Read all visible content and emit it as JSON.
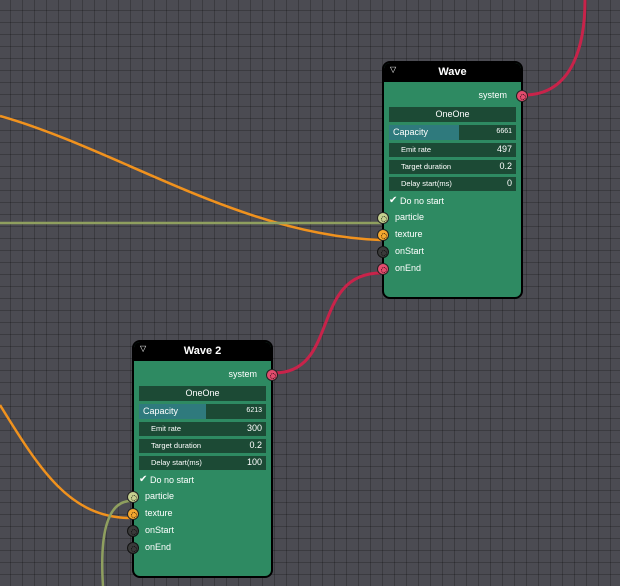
{
  "nodes": [
    {
      "title": "Wave",
      "output_port": "system",
      "mode": "OneOne",
      "capacity": {
        "label": "Capacity",
        "value": "6661",
        "fill_fraction": 0.55
      },
      "fields": [
        {
          "label": "Emit rate",
          "value": "497"
        },
        {
          "label": "Target duration",
          "value": "0.2"
        },
        {
          "label": "Delay start(ms)",
          "value": "0"
        }
      ],
      "checkbox": {
        "label": "Do no start",
        "checked": true
      },
      "inputs": [
        "particle",
        "texture",
        "onStart",
        "onEnd"
      ]
    },
    {
      "title": "Wave 2",
      "output_port": "system",
      "mode": "OneOne",
      "capacity": {
        "label": "Capacity",
        "value": "6213",
        "fill_fraction": 0.53
      },
      "fields": [
        {
          "label": "Emit rate",
          "value": "300"
        },
        {
          "label": "Target duration",
          "value": "0.2"
        },
        {
          "label": "Delay start(ms)",
          "value": "100"
        }
      ],
      "checkbox": {
        "label": "Do no start",
        "checked": true
      },
      "inputs": [
        "particle",
        "texture",
        "onStart",
        "onEnd"
      ]
    }
  ],
  "colors": {
    "canvas_bg": "#4b4b52",
    "node_bg": "#2e8a62",
    "wire_red": "#c8234a",
    "wire_orange": "#f0921e",
    "wire_green": "#8f9f5f"
  }
}
